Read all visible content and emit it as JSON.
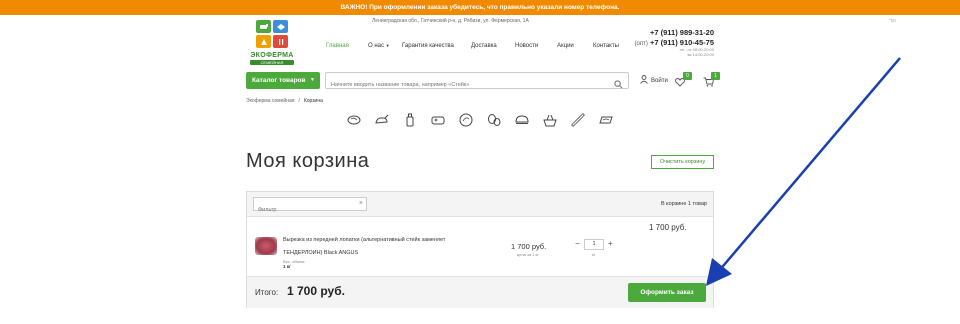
{
  "topbar": {
    "notice": "ВАЖНО! При оформлении заказа убедитесь, что правильно указали номер телефона."
  },
  "logo": {
    "name": "ЭКОФЕРМА",
    "subtitle": "СЕМЕЙНАЯ"
  },
  "header": {
    "address": "Ленинградская обл., Гатчинский р-н, д. Рябизи, ул. Фермерская, 1А",
    "mark": "\"10",
    "phone1": "+7 (911) 989-31-20",
    "phone2_prefix": "(опт)",
    "phone2": "+7 (911) 910-45-75",
    "hours1": "пн - пт 08:00-20:00",
    "hours2": "вс 14:00-20:00"
  },
  "nav": {
    "items": [
      "Главная",
      "О нас",
      "Гарантия качества",
      "Доставка",
      "Новости",
      "Акции",
      "Контакты"
    ]
  },
  "search": {
    "catalog_label": "Каталог товаров",
    "placeholder": "Начните вводить название товара, например «Стейк»",
    "login_label": "Войти",
    "fav_count": "0",
    "cart_count": "1"
  },
  "breadcrumb": {
    "home": "Экоферма семейная",
    "sep": "/",
    "current": "Корзина"
  },
  "category_icons": [
    "steak-icon",
    "chicken-icon",
    "milk-bottle-icon",
    "cheese-icon",
    "plate-icon",
    "eggs-icon",
    "bread-icon",
    "basket-icon",
    "sausage-icon",
    "dumplings-icon"
  ],
  "page": {
    "title": "Моя корзина",
    "clear_label": "Очистить корзину"
  },
  "cart": {
    "filter_placeholder": "Фильтр",
    "in_cart": "В корзине 1 товар",
    "item": {
      "name_line1": "Вырезка из передней лопатки (альтернативный стейк заменяет",
      "name_line2": "ТЕНДЕРЛОИН) Black ANGUS",
      "prop_label": "Вес, объем:",
      "prop_value": "1 кг",
      "unit_price": "1 700 руб.",
      "unit_note": "цена за 1 кг",
      "qty": "1",
      "qty_unit": "кг",
      "total": "1 700 руб."
    },
    "total_label": "Итого:",
    "total_value": "1 700 руб.",
    "order_label": "Оформить заказ"
  },
  "colors": {
    "brand_green": "#4caa3c",
    "topbar_orange": "#f08a00",
    "arrow_blue": "#1a3fb0"
  }
}
